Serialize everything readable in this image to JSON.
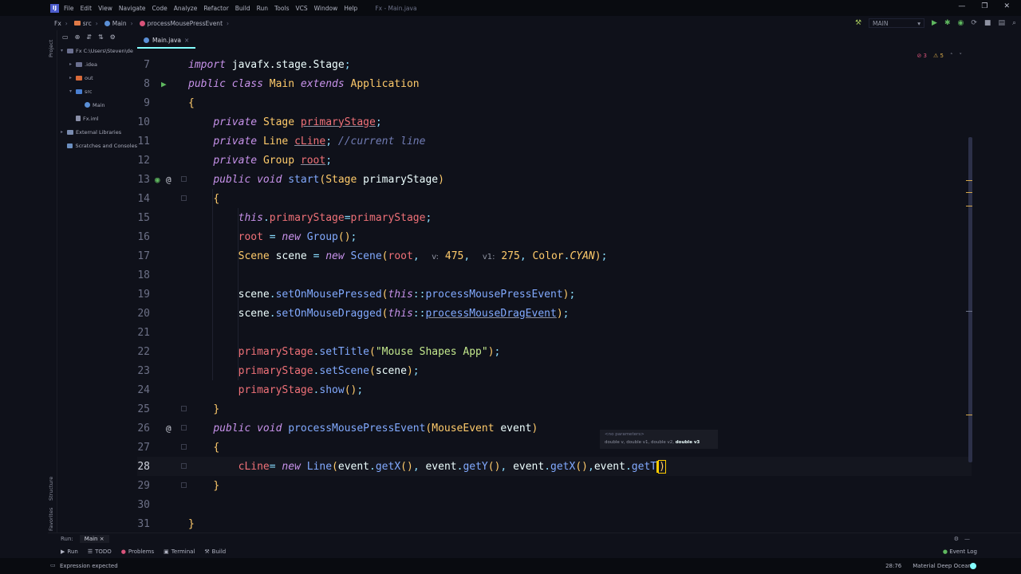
{
  "window": {
    "logo": "IJ",
    "title": "Fx - Main.java",
    "controls": [
      "—",
      "❐",
      "✕"
    ]
  },
  "menu": [
    "File",
    "Edit",
    "View",
    "Navigate",
    "Code",
    "Analyze",
    "Refactor",
    "Build",
    "Run",
    "Tools",
    "VCS",
    "Window",
    "Help"
  ],
  "breadcrumb": [
    "Fx",
    "src",
    "Main",
    "processMousePressEvent"
  ],
  "run_config": "MAIN",
  "side_tools": {
    "project": "Project",
    "structure": "Structure",
    "favorites": "Favorites"
  },
  "project_tree": [
    {
      "label": "Fx  C:\\Users\\Steven\\de",
      "icon": "gray",
      "arrow": "▾",
      "indent": 0
    },
    {
      "label": ".idea",
      "icon": "gray",
      "arrow": "▸",
      "indent": 1
    },
    {
      "label": "out",
      "icon": "orange",
      "arrow": "▸",
      "indent": 1
    },
    {
      "label": "src",
      "icon": "blue",
      "arrow": "▾",
      "indent": 1
    },
    {
      "label": "Main",
      "icon": "teal",
      "arrow": "",
      "indent": 2
    },
    {
      "label": "Fx.iml",
      "icon": "file",
      "arrow": "",
      "indent": 1
    },
    {
      "label": "External Libraries",
      "icon": "lib",
      "arrow": "▸",
      "indent": 0
    },
    {
      "label": "Scratches and Consoles",
      "icon": "scr",
      "arrow": "",
      "indent": 0
    }
  ],
  "editor_tab": "Main.java",
  "inspection": {
    "errors": "3",
    "warnings": "5"
  },
  "code_lines": [
    {
      "n": "7",
      "html": "<span class=\"k\">import</span> <span class=\"v\">javafx.stage.Stage</span><span class=\"p\">;</span>"
    },
    {
      "n": "8",
      "html": "<span class=\"k\">public class</span> <span class=\"t\">Main</span> <span class=\"k\">extends</span> <span class=\"t\">Application</span>"
    },
    {
      "n": "9",
      "html": "<span class=\"t\">{</span>"
    },
    {
      "n": "10",
      "html": "    <span class=\"k\">private</span> <span class=\"t\">Stage</span> <span class=\"fd u\">primaryStage</span><span class=\"p\">;</span>"
    },
    {
      "n": "11",
      "html": "    <span class=\"k\">private</span> <span class=\"t\">Line</span> <span class=\"fd u\">cLine</span><span class=\"p\">;</span> <span class=\"c\">//current line</span>"
    },
    {
      "n": "12",
      "html": "    <span class=\"k\">private</span> <span class=\"t\">Group</span> <span class=\"fd u\">root</span><span class=\"p\">;</span>"
    },
    {
      "n": "13",
      "html": "    <span class=\"k\">public void</span> <span class=\"f\">start</span><span class=\"t\">(</span><span class=\"t\">Stage</span> <span class=\"v\">primaryStage</span><span class=\"t\">)</span>"
    },
    {
      "n": "14",
      "html": "    <span class=\"t\">{</span>"
    },
    {
      "n": "15",
      "html": "        <span class=\"k\">this</span><span class=\"p\">.</span><span class=\"fd\">primaryStage</span><span class=\"p\">=</span><span class=\"fd\">primaryStage</span><span class=\"p\">;</span>"
    },
    {
      "n": "16",
      "html": "        <span class=\"fd\">root</span> <span class=\"p\">=</span> <span class=\"k\">new</span> <span class=\"f\">Group</span><span class=\"t\">()</span><span class=\"p\">;</span>"
    },
    {
      "n": "17",
      "html": "        <span class=\"t\">Scene</span> <span class=\"v\">scene</span> <span class=\"p\">=</span> <span class=\"k\">new</span> <span class=\"f\">Scene</span><span class=\"t\">(</span><span class=\"fd\">root</span><span class=\"p\">,</span>  <span class=\"hint\">v:</span> <span class=\"t\">475</span><span class=\"p\">,</span>  <span class=\"hint\">v1:</span> <span class=\"t\">275</span><span class=\"p\">,</span> <span class=\"t\">Color</span><span class=\"p\">.</span><span class=\"cst\">CYAN</span><span class=\"t\">)</span><span class=\"p\">;</span>"
    },
    {
      "n": "18",
      "html": ""
    },
    {
      "n": "19",
      "html": "        <span class=\"v\">scene</span><span class=\"p\">.</span><span class=\"f\">setOnMousePressed</span><span class=\"t\">(</span><span class=\"k\">this</span><span class=\"p\">::</span><span class=\"f\">processMousePressEvent</span><span class=\"t\">)</span><span class=\"p\">;</span>"
    },
    {
      "n": "20",
      "html": "        <span class=\"v\">scene</span><span class=\"p\">.</span><span class=\"f\">setOnMouseDragged</span><span class=\"t\">(</span><span class=\"k\">this</span><span class=\"p\">::</span><span class=\"f u\">processMouseDragEvent</span><span class=\"t\">)</span><span class=\"p\">;</span>"
    },
    {
      "n": "21",
      "html": ""
    },
    {
      "n": "22",
      "html": "        <span class=\"fd\">primaryStage</span><span class=\"p\">.</span><span class=\"f\">setTitle</span><span class=\"t\">(</span><span class=\"s\">\"Mouse Shapes App\"</span><span class=\"t\">)</span><span class=\"p\">;</span>"
    },
    {
      "n": "23",
      "html": "        <span class=\"fd\">primaryStage</span><span class=\"p\">.</span><span class=\"f\">setScene</span><span class=\"t\">(</span><span class=\"v\">scene</span><span class=\"t\">)</span><span class=\"p\">;</span>"
    },
    {
      "n": "24",
      "html": "        <span class=\"fd\">primaryStage</span><span class=\"p\">.</span><span class=\"f\">show</span><span class=\"t\">()</span><span class=\"p\">;</span>"
    },
    {
      "n": "25",
      "html": "    <span class=\"t\">}</span>"
    },
    {
      "n": "26",
      "html": "    <span class=\"k\">public void</span> <span class=\"f\">processMousePressEvent</span><span class=\"t\">(</span><span class=\"t\">MouseEvent</span> <span class=\"v\">event</span><span class=\"t\">)</span>"
    },
    {
      "n": "27",
      "html": "    <span class=\"t\">{</span>"
    },
    {
      "n": "28",
      "html": "        <span class=\"fd\">cLine</span><span class=\"p\">=</span> <span class=\"k\">new</span> <span class=\"f\">Line</span><span class=\"t\">(</span><span class=\"v\">event</span><span class=\"p\">.</span><span class=\"f\">getX</span><span class=\"t\">()</span><span class=\"p\">,</span> <span class=\"v\">event</span><span class=\"p\">.</span><span class=\"f\">getY</span><span class=\"t\">()</span><span class=\"p\">,</span> <span class=\"v\">event</span><span class=\"p\">.</span><span class=\"f\">getX</span><span class=\"t\">()</span><span class=\"p\">,</span><span class=\"v\">event</span><span class=\"p\">.</span><span class=\"f\">getT</span><span class=\"caret\"></span><span class=\"t errbox\">)</span>"
    },
    {
      "n": "29",
      "html": "    <span class=\"t\">}</span>"
    },
    {
      "n": "30",
      "html": ""
    },
    {
      "n": "31",
      "html": "<span class=\"t\">}</span>"
    }
  ],
  "param_popup": {
    "header": "<no parameters>",
    "params": "double v, double v1, double v2, ",
    "current": "double v3"
  },
  "bottom": {
    "run_label": "Run:",
    "run_tab": "Main",
    "tools": [
      "Run",
      "TODO",
      "Problems",
      "Terminal",
      "Build"
    ],
    "event_log": "Event Log"
  },
  "status": {
    "message": "Expression expected",
    "position": "28:76",
    "theme": "Material Deep Ocean"
  },
  "colors": {
    "background": "#0f111a",
    "accent": "#84ffff",
    "keyword": "#c792ea",
    "type": "#ffcb6b",
    "function": "#82aaff",
    "field": "#f07178",
    "string": "#c3e88d"
  }
}
